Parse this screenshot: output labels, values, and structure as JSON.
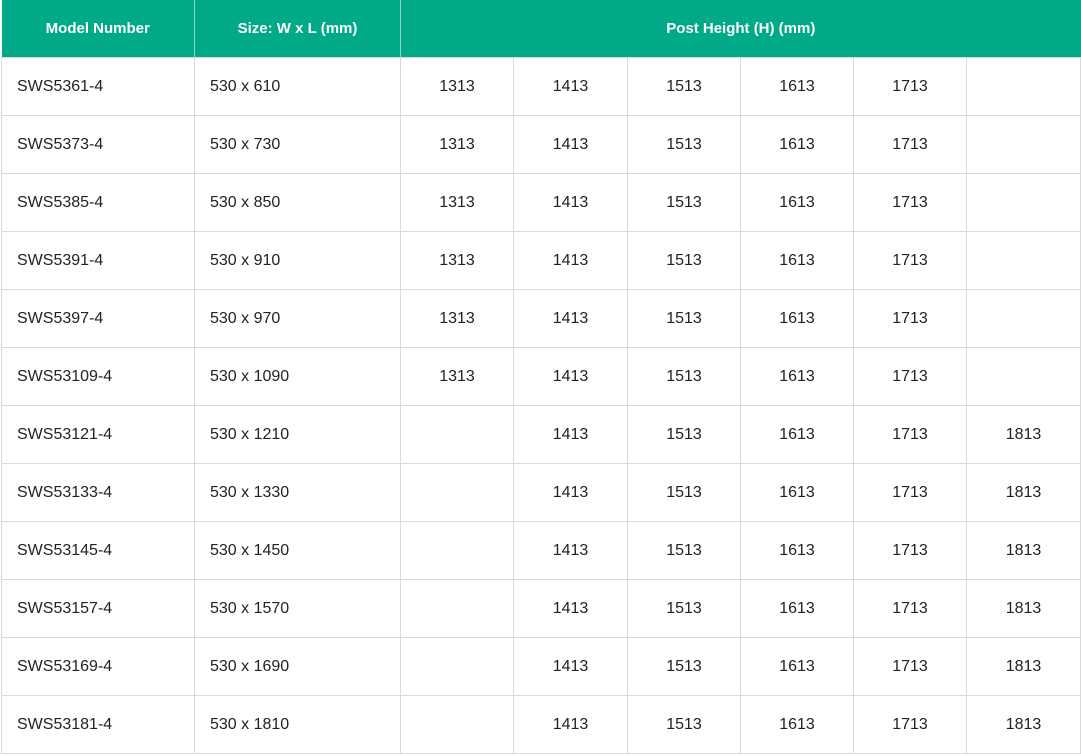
{
  "header": {
    "model": "Model Number",
    "size": "Size: W x L (mm)",
    "post_height": "Post Height (H) (mm)"
  },
  "rows": [
    {
      "model": "SWS5361-4",
      "size": "530 x 610",
      "heights": [
        "1313",
        "1413",
        "1513",
        "1613",
        "1713",
        ""
      ]
    },
    {
      "model": "SWS5373-4",
      "size": "530 x 730",
      "heights": [
        "1313",
        "1413",
        "1513",
        "1613",
        "1713",
        ""
      ]
    },
    {
      "model": "SWS5385-4",
      "size": "530 x 850",
      "heights": [
        "1313",
        "1413",
        "1513",
        "1613",
        "1713",
        ""
      ]
    },
    {
      "model": "SWS5391-4",
      "size": "530 x 910",
      "heights": [
        "1313",
        "1413",
        "1513",
        "1613",
        "1713",
        ""
      ]
    },
    {
      "model": "SWS5397-4",
      "size": "530 x 970",
      "heights": [
        "1313",
        "1413",
        "1513",
        "1613",
        "1713",
        ""
      ]
    },
    {
      "model": "SWS53109-4",
      "size": "530 x 1090",
      "heights": [
        "1313",
        "1413",
        "1513",
        "1613",
        "1713",
        ""
      ]
    },
    {
      "model": "SWS53121-4",
      "size": "530 x 1210",
      "heights": [
        "",
        "1413",
        "1513",
        "1613",
        "1713",
        "1813"
      ]
    },
    {
      "model": "SWS53133-4",
      "size": "530 x 1330",
      "heights": [
        "",
        "1413",
        "1513",
        "1613",
        "1713",
        "1813"
      ]
    },
    {
      "model": "SWS53145-4",
      "size": "530 x 1450",
      "heights": [
        "",
        "1413",
        "1513",
        "1613",
        "1713",
        "1813"
      ]
    },
    {
      "model": "SWS53157-4",
      "size": "530 x 1570",
      "heights": [
        "",
        "1413",
        "1513",
        "1613",
        "1713",
        "1813"
      ]
    },
    {
      "model": "SWS53169-4",
      "size": "530 x 1690",
      "heights": [
        "",
        "1413",
        "1513",
        "1613",
        "1713",
        "1813"
      ]
    },
    {
      "model": "SWS53181-4",
      "size": "530 x 1810",
      "heights": [
        "",
        "1413",
        "1513",
        "1613",
        "1713",
        "1813"
      ]
    }
  ],
  "colors": {
    "header_bg": "#00a987",
    "header_text": "#ffffff",
    "cell_text": "#222222",
    "grid_line": "#d9d9d9"
  }
}
